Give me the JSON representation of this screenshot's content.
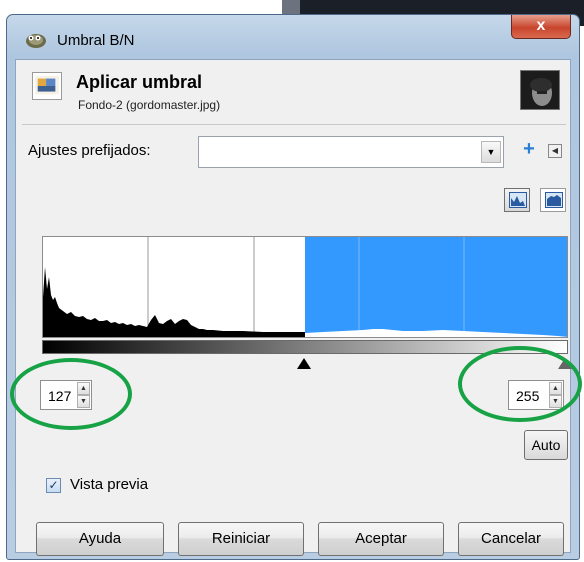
{
  "window": {
    "title": "Umbral B/N",
    "close_label": "x"
  },
  "header": {
    "title": "Aplicar umbral",
    "subtitle": "Fondo-2 (gordomaster.jpg)"
  },
  "presets": {
    "label": "Ajustes prefijados:",
    "value": ""
  },
  "threshold": {
    "low": "127",
    "high": "255",
    "low_fraction": 0.498,
    "high_fraction": 1.0
  },
  "auto_label": "Auto",
  "preview": {
    "label": "Vista previa",
    "checked": true
  },
  "buttons": {
    "help": "Ayuda",
    "reset": "Reiniciar",
    "ok": "Aceptar",
    "cancel": "Cancelar"
  },
  "colors": {
    "selection": "#3399ff",
    "highlight": "#17a245"
  },
  "icons": {
    "window": "gimp-icon",
    "header": "threshold-tool-icon",
    "add": "plus-icon",
    "menu": "menu-arrow-icon",
    "linear": "linear-histogram-icon",
    "log": "logarithmic-histogram-icon"
  }
}
